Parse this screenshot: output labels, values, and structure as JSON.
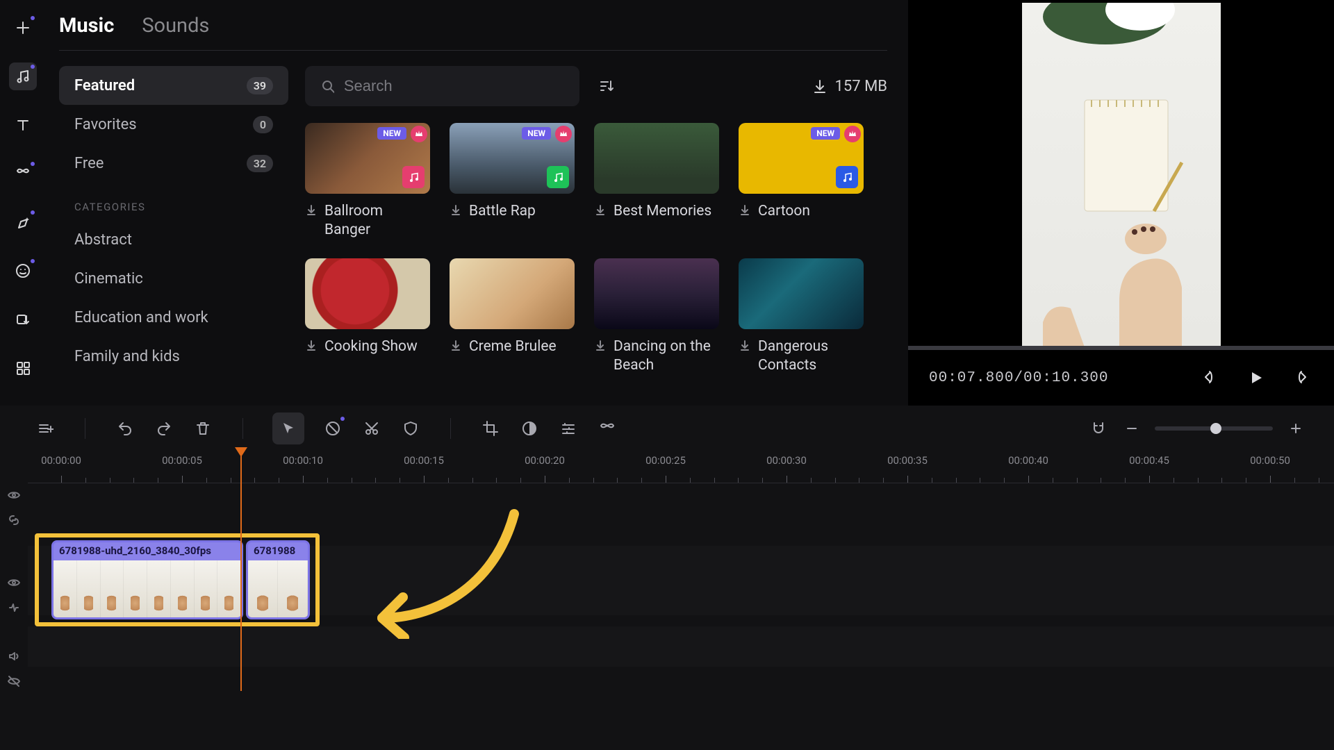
{
  "tabs": {
    "music": "Music",
    "sounds": "Sounds"
  },
  "search": {
    "placeholder": "Search"
  },
  "download_size": "157 MB",
  "sidebar": {
    "items": [
      {
        "label": "Featured",
        "badge": "39"
      },
      {
        "label": "Favorites",
        "badge": "0"
      },
      {
        "label": "Free",
        "badge": "32"
      }
    ],
    "categories_label": "CATEGORIES",
    "categories": [
      {
        "label": "Abstract"
      },
      {
        "label": "Cinematic"
      },
      {
        "label": "Education and work"
      },
      {
        "label": "Family and kids"
      }
    ]
  },
  "tags": {
    "new": "NEW"
  },
  "tracks": [
    {
      "title": "Ballroom Banger",
      "thumb": "bg-selfie",
      "new": true,
      "crown": true,
      "type_badge": "#e53e6f"
    },
    {
      "title": "Battle Rap",
      "thumb": "bg-city",
      "new": true,
      "crown": true,
      "type_badge": "#1ec258"
    },
    {
      "title": "Best Memories",
      "thumb": "bg-forest",
      "new": false,
      "crown": false,
      "type_badge": ""
    },
    {
      "title": "Cartoon",
      "thumb": "bg-cartoon",
      "new": true,
      "crown": true,
      "type_badge": "#2a5ae6"
    },
    {
      "title": "Cooking Show",
      "thumb": "bg-cook",
      "new": false,
      "crown": false,
      "type_badge": ""
    },
    {
      "title": "Creme Brulee",
      "thumb": "bg-creme",
      "new": false,
      "crown": false,
      "type_badge": ""
    },
    {
      "title": "Dancing on the Beach",
      "thumb": "bg-dance",
      "new": false,
      "crown": false,
      "type_badge": ""
    },
    {
      "title": "Dangerous Contacts",
      "thumb": "bg-danger",
      "new": false,
      "crown": false,
      "type_badge": ""
    }
  ],
  "preview": {
    "current": "00:07.800",
    "total": "00:10.300"
  },
  "ruler": [
    "00:00:00",
    "00:00:05",
    "00:00:10",
    "00:00:15",
    "00:00:20",
    "00:00:25",
    "00:00:30",
    "00:00:35",
    "00:00:40",
    "00:00:45",
    "00:00:50"
  ],
  "clips": [
    {
      "label": "6781988-uhd_2160_3840_30fps"
    },
    {
      "label": "6781988"
    }
  ]
}
